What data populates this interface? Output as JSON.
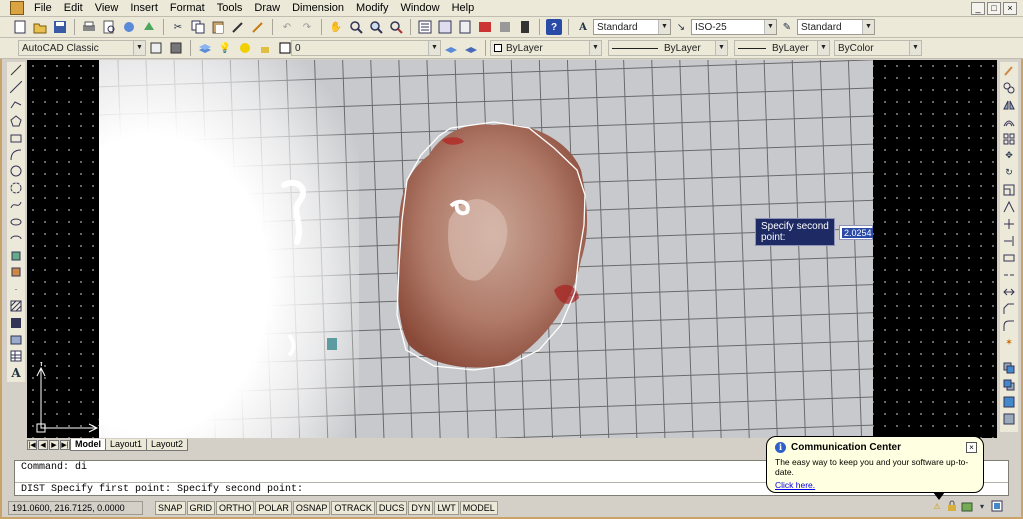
{
  "menu": [
    "File",
    "Edit",
    "View",
    "Insert",
    "Format",
    "Tools",
    "Draw",
    "Dimension",
    "Modify",
    "Window",
    "Help"
  ],
  "window_controls": [
    "_",
    "□",
    "×"
  ],
  "toolbar": {
    "text_style": "Standard",
    "dim_style": "ISO-25",
    "table_style": "Standard",
    "workspace": "AutoCAD Classic",
    "layer": "0",
    "color": "ByLayer",
    "linetype": "ByLayer",
    "lineweight": "ByLayer",
    "plotstyle": "ByColor"
  },
  "dynamic_input": {
    "prompt": "Specify second point:",
    "value": "2.0254"
  },
  "ucs": {
    "y_label": "Y",
    "x_label": "X"
  },
  "layout_tabs": [
    "Model",
    "Layout1",
    "Layout2"
  ],
  "layout_nav": [
    "|◀",
    "◀",
    "▶",
    "▶|"
  ],
  "command": {
    "line1": "Command: di",
    "line2": "DIST Specify first point:  Specify second point:"
  },
  "status": {
    "coords": "191.0600, 216.7125, 0.0000",
    "buttons": [
      "SNAP",
      "GRID",
      "ORTHO",
      "POLAR",
      "OSNAP",
      "OTRACK",
      "DUCS",
      "DYN",
      "LWT",
      "MODEL"
    ]
  },
  "comm_center": {
    "title": "Communication Center",
    "text": "The easy way to keep you and your software up-to-date.",
    "link": "Click here.",
    "close": "×"
  },
  "colors": {
    "toolbar_bg": "#ece9d8",
    "canvas_bg": "#000000",
    "tooltip_bg": "#1e2a64",
    "balloon_bg": "#ffffe1",
    "outline": "#ffffff"
  }
}
